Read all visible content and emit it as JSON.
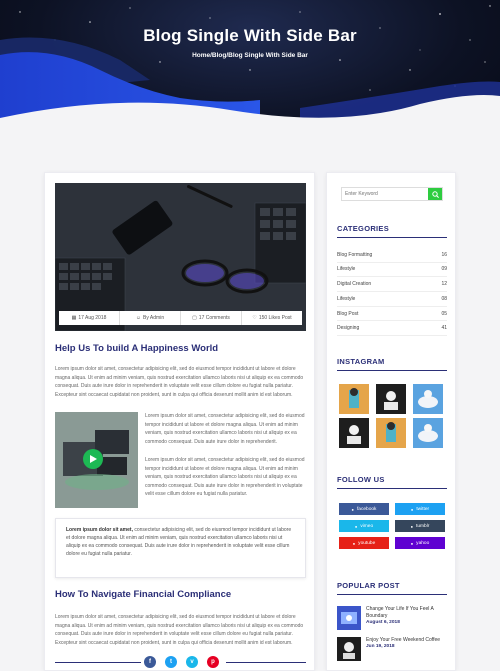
{
  "hero": {
    "title": "Blog Single With Side Bar",
    "breadcrumb": "Home/Blog/Blog Single With Side Bar"
  },
  "post": {
    "meta": {
      "date": "17 Aug 2018",
      "author": "By Admin",
      "comments": "17 Comments",
      "likes": "150 Likes Post"
    },
    "title": "Help Us To build A Happiness World",
    "intro": "Lorem ipsum dolor sit amet, consectetur adipisicing elit, sed do eiusmod tempor incididunt ut labore et dolore magna aliqua. Ut enim ad minim veniam, quis nostrud exercitation ullamco laboris nisi ut aliquip ex ea commodo consequat. Duis aute irure dolor in reprehenderit in voluptate velit esse cillum dolore eu fugiat nulla pariatur. Excepteur sint occaecat cupidatat non proident, sunt in culpa qui officia deserunt mollit anim id est laborum.",
    "side_para_1": "Lorem ipsum dolor sit amet, consectetur adipisicing elit, sed do eiusmod tempor incididunt ut labore et dolore magna aliqua. Ut enim ad minim veniam, quis nostrud exercitation ullamco laboris nisi ut aliquip ex ea commodo consequat. Duis aute irure dolor in reprehenderit.",
    "side_para_2": "Lorem ipsum dolor sit amet, consectetur adipisicing elit, sed do eiusmod tempor incididunt ut labore et dolore magna aliqua. Ut enim ad minim veniam, quis nostrud exercitation ullamco laboris nisi ut aliquip ex ea commodo consequat. Duis aute irure dolor in reprehenderit in voluptate velit esse cillum dolore eu fugiat nulla pariatur.",
    "quote_lead": "Lorem ipsum dolor sit amet,",
    "quote_body": " consectetur adipisicing elit, sed do eiusmod tempor incididunt ut labore et dolore magna aliqua. Ut enim ad minim veniam, quis nostrud exercitation ullamco laboris nisi ut aliquip ex ea commodo consequat. Duis aute irure dolor in reprehenderit in voluptate velit esse cillum dolore eu fugiat nulla pariatur.",
    "title2": "How To Navigate Financial Compliance",
    "para2": "Lorem ipsum dolor sit amet, consectetur adipisicing elit, sed do eiusmod tempor incididunt ut labore et dolore magna aliqua. Ut enim ad minim veniam, quis nostrud exercitation ullamco laboris nisi ut aliquip ex ea commodo consequat. Duis aute irure dolor in reprehenderit in voluptate velit esse cillum dolore eu fugiat nulla pariatur. Excepteur sint occaecat cupidatat non proident, sunt in culpa qui officia deserunt mollit anim id est laborum."
  },
  "share": {
    "buttons": [
      {
        "glyph": "f",
        "color": "#3b5998"
      },
      {
        "glyph": "t",
        "color": "#1da1f2"
      },
      {
        "glyph": "v",
        "color": "#1ab7ea"
      },
      {
        "glyph": "p",
        "color": "#e60023"
      }
    ]
  },
  "sidebar": {
    "search_placeholder": "Enter Keyword",
    "categories_title": "CATEGORIES",
    "categories": [
      {
        "name": "Blog Formatting",
        "count": "16"
      },
      {
        "name": "Lifestyle",
        "count": "09"
      },
      {
        "name": "Digital Creation",
        "count": "12"
      },
      {
        "name": "Lifestyle",
        "count": "08"
      },
      {
        "name": "Blog Post",
        "count": "05"
      },
      {
        "name": "Designing",
        "count": "41"
      }
    ],
    "instagram_title": "INSTAGRAM",
    "follow_title": "FOLLOW US",
    "follow": [
      {
        "label": "facebook",
        "color": "#3b5998"
      },
      {
        "label": "twitter",
        "color": "#1da1f2"
      },
      {
        "label": "vimeo",
        "color": "#1ab7ea"
      },
      {
        "label": "tumblr",
        "color": "#35465c"
      },
      {
        "label": "youtube",
        "color": "#e62117"
      },
      {
        "label": "yahoo",
        "color": "#5f01d1"
      }
    ],
    "popular_title": "POPULAR POST",
    "popular": [
      {
        "title": "Change Your Life If You Feel A Boundary",
        "date": "August 6, 2018"
      },
      {
        "title": "Enjoy Your Free Weekend Coffee",
        "date": "Jun 19, 2018"
      }
    ]
  },
  "colors": {
    "accent": "#2b2f77",
    "search_button": "#2ecc40",
    "play_button": "#1db954"
  }
}
